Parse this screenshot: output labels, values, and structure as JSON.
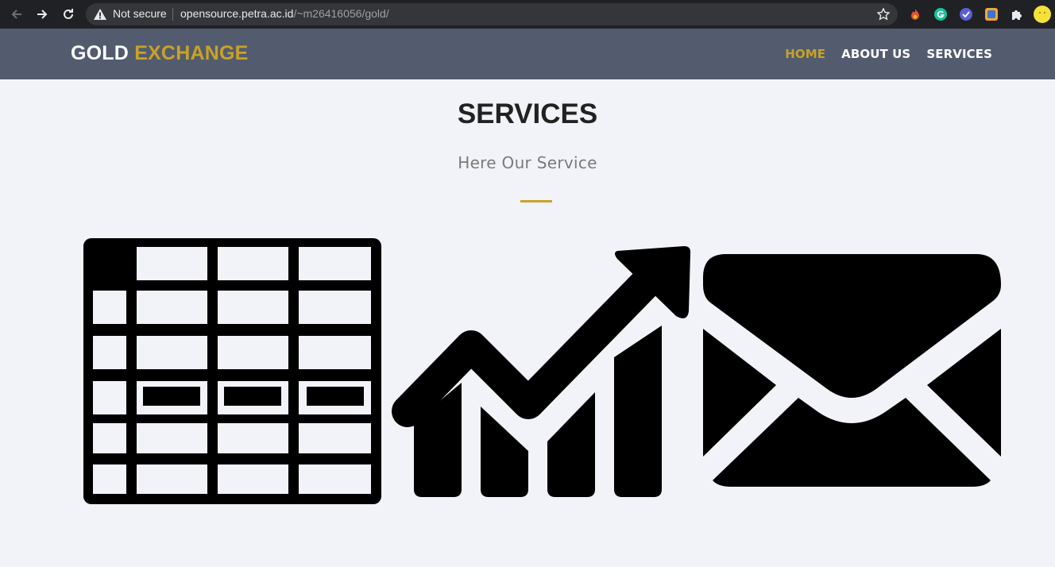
{
  "browser": {
    "security_label": "Not secure",
    "url_host": "opensource.petra.ac.id",
    "url_path": "/~m26416056/gold/"
  },
  "site": {
    "brand_first": "GOLD",
    "brand_second": "EXCHANGE",
    "nav": [
      {
        "label": "HOME",
        "active": true
      },
      {
        "label": "ABOUT US",
        "active": false
      },
      {
        "label": "SERVICES",
        "active": false
      }
    ]
  },
  "services": {
    "title": "SERVICES",
    "subtitle": "Here Our Service",
    "icons": [
      "spreadsheet-icon",
      "growth-chart-icon",
      "envelope-icon"
    ]
  },
  "colors": {
    "accent": "#c9a227",
    "header_bg": "#525c6e",
    "section_bg": "#f2f3f8"
  }
}
